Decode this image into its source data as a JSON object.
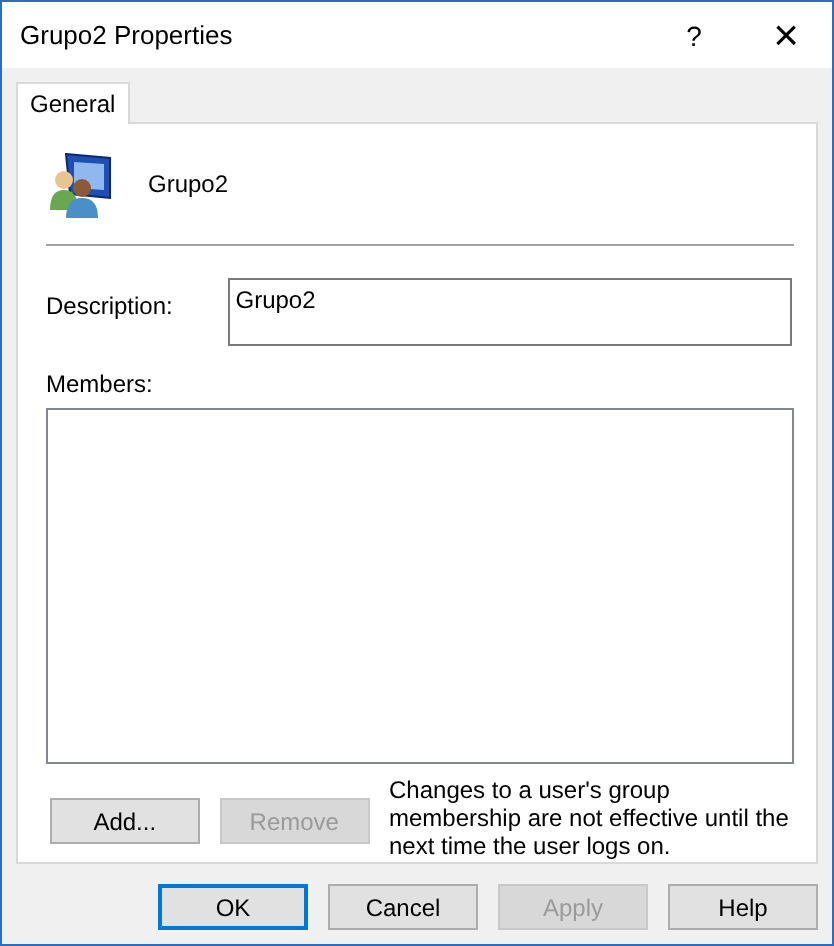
{
  "window": {
    "title": "Grupo2 Properties",
    "help_button": "?",
    "close_button": "×"
  },
  "tabs": [
    {
      "label": "General",
      "selected": true
    }
  ],
  "group": {
    "name": "Grupo2"
  },
  "description": {
    "label": "Description:",
    "value": "Grupo2"
  },
  "members": {
    "label": "Members:"
  },
  "member_buttons": [
    {
      "label": "Add...",
      "disabled": false
    },
    {
      "label": "Remove",
      "disabled": true
    }
  ],
  "note": "Changes to a user's group membership are not effective until the next time the user logs on.",
  "buttons": [
    {
      "label": "OK",
      "disabled": false,
      "default": true
    },
    {
      "label": "Cancel",
      "disabled": false,
      "default": false
    },
    {
      "label": "Apply",
      "disabled": true,
      "default": false
    },
    {
      "label": "Help",
      "disabled": false,
      "default": false
    }
  ]
}
